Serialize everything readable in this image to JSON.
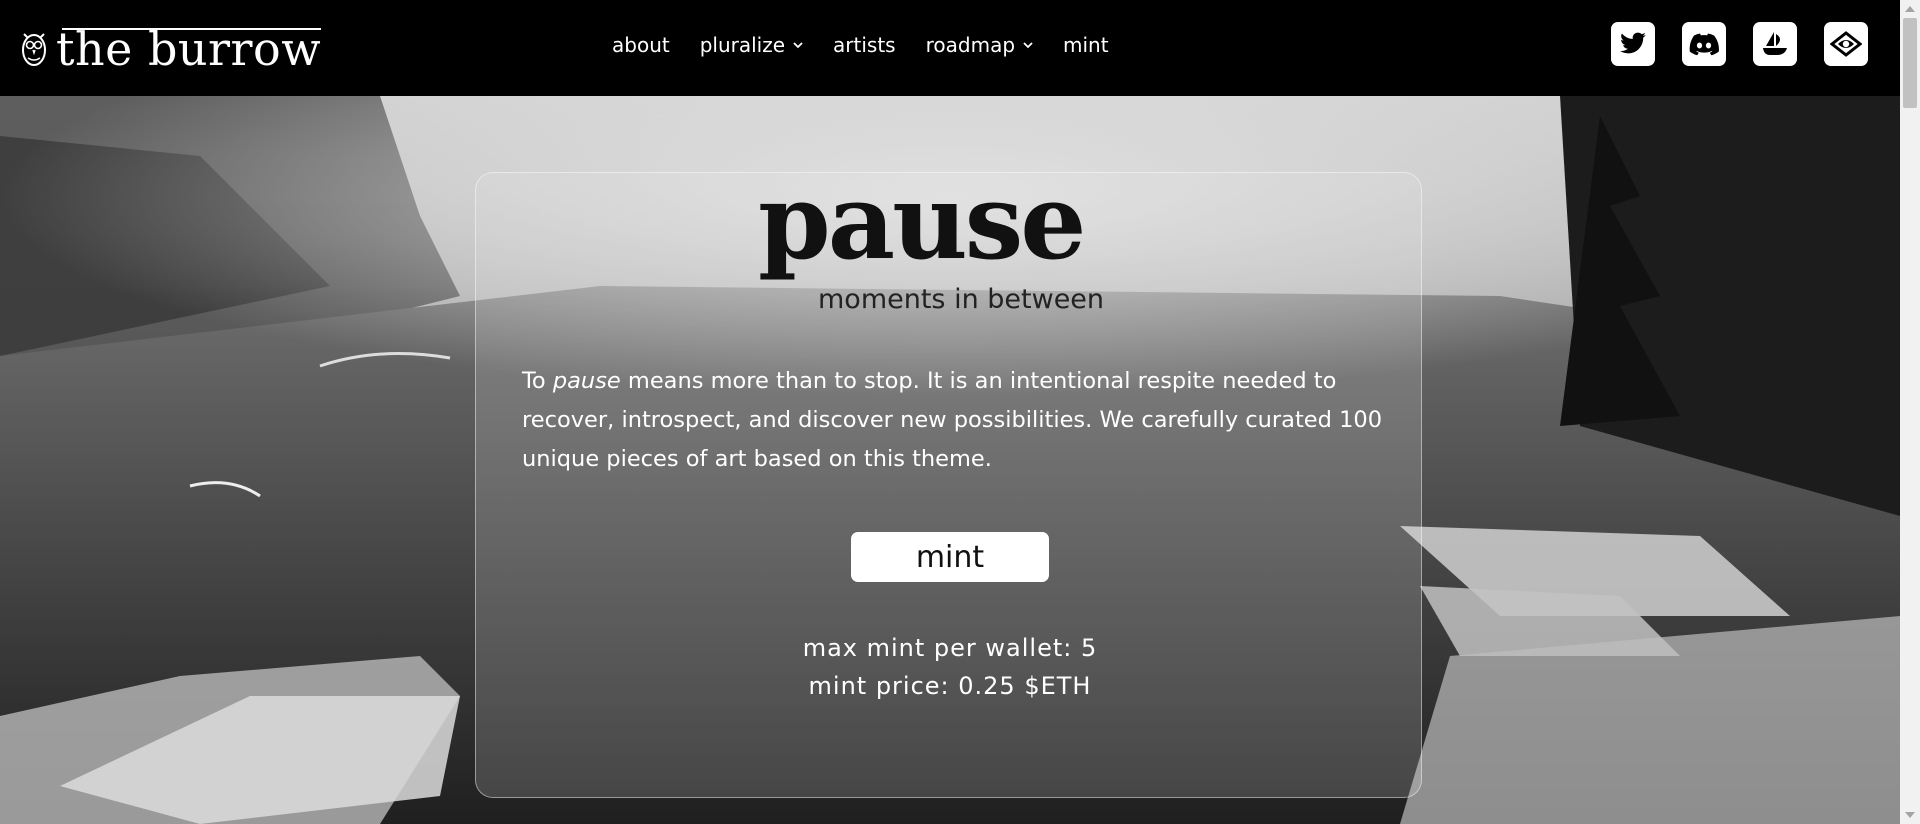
{
  "brand": {
    "name": "the burrow",
    "logo_icon": "owl-icon"
  },
  "nav": {
    "items": [
      {
        "label": "about",
        "has_dropdown": false
      },
      {
        "label": "pluralize",
        "has_dropdown": true
      },
      {
        "label": "artists",
        "has_dropdown": false
      },
      {
        "label": "roadmap",
        "has_dropdown": true
      },
      {
        "label": "mint",
        "has_dropdown": false
      }
    ]
  },
  "socials": [
    "twitter-icon",
    "discord-icon",
    "opensea-icon",
    "eye-icon"
  ],
  "collection": {
    "title": "pause",
    "subtitle": "moments in between",
    "description_prefix": "To ",
    "description_emphasis": "pause",
    "description_rest": " means more than to stop. It is an intentional respite needed to recover, introspect, and discover new possibilities. We carefully curated 100 unique pieces of art based on this theme.",
    "mint_button": "mint",
    "max_mint": "max mint per wallet: 5",
    "mint_price": "mint price: 0.25 $ETH"
  },
  "colors": {
    "topbar": "#000000",
    "card_border": "#cfcfcf",
    "button_bg": "#ffffff"
  }
}
